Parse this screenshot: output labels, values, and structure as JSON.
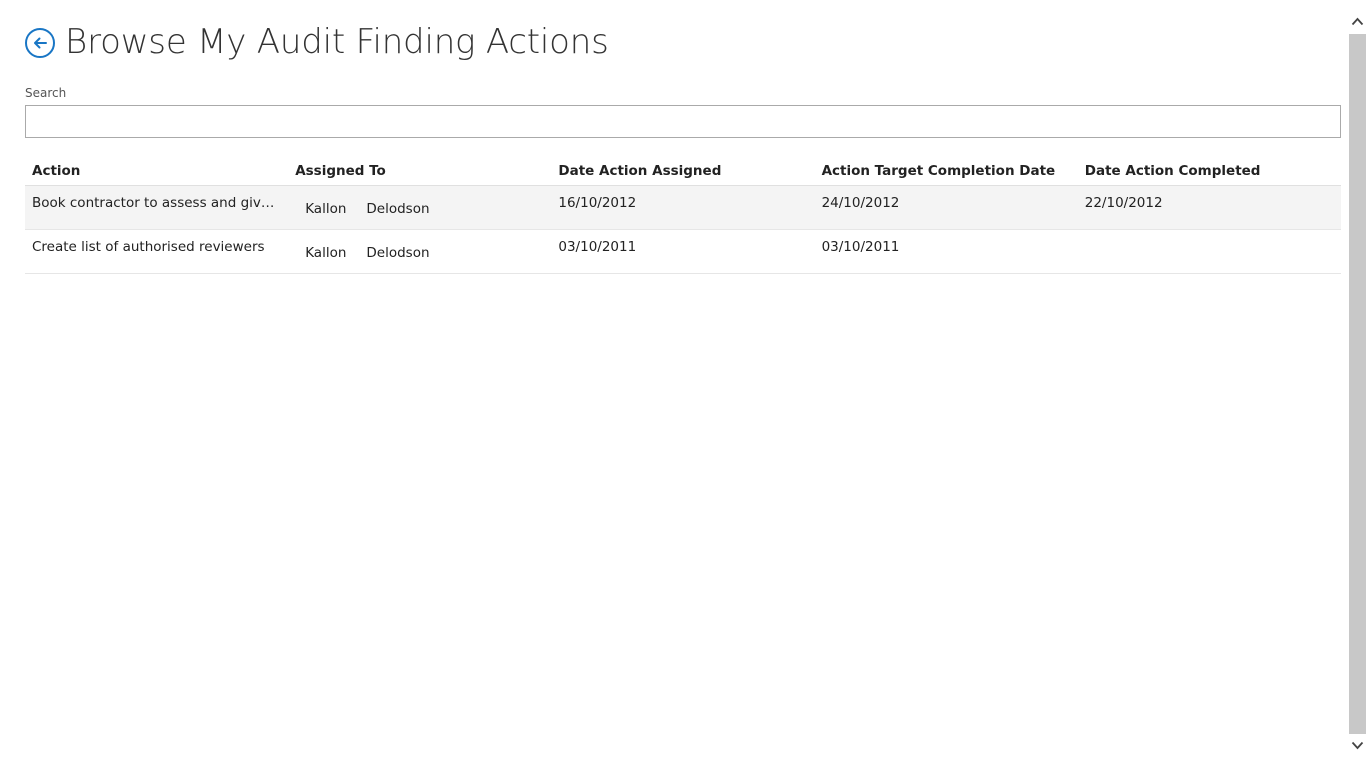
{
  "header": {
    "title": "Browse My Audit Finding Actions",
    "back_icon": "back-arrow-circle-icon",
    "accent_color": "#1976c5"
  },
  "search": {
    "label": "Search",
    "value": "",
    "placeholder": ""
  },
  "table": {
    "columns": [
      "Action",
      "Assigned To",
      "Date Action Assigned",
      "Action Target Completion Date",
      "Date Action Completed"
    ],
    "rows": [
      {
        "action": "Book contractor to assess and give qu…",
        "assigned_first": "Kallon",
        "assigned_last": "Delodson",
        "date_assigned": "16/10/2012",
        "target_date": "24/10/2012",
        "completed_date": "22/10/2012"
      },
      {
        "action": "Create list of authorised reviewers",
        "assigned_first": "Kallon",
        "assigned_last": "Delodson",
        "date_assigned": "03/10/2011",
        "target_date": "03/10/2011",
        "completed_date": ""
      }
    ]
  },
  "scrollbar": {
    "up_icon": "chevron-up-icon",
    "down_icon": "chevron-down-icon"
  }
}
